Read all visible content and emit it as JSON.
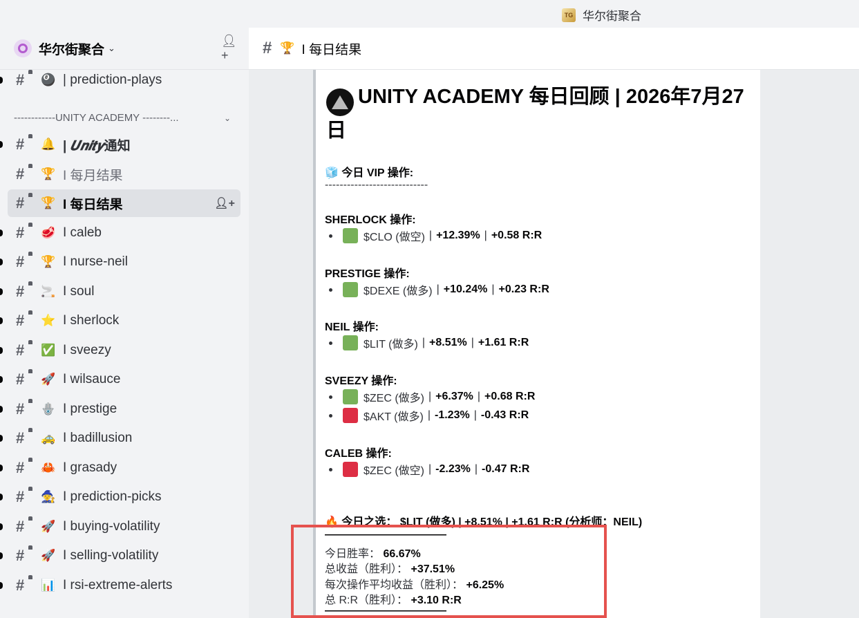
{
  "titlebar": {
    "server_name": "华尔街聚合",
    "logo_text": "TG"
  },
  "sidebar": {
    "server_name": "华尔街聚合",
    "category": "------------UNITY ACADEMY --------...",
    "channels": [
      {
        "emoji": "🎱",
        "label": "| prediction-plays"
      },
      {
        "emoji": "🔔",
        "label_prefix": "| ",
        "label_italic": "𝑼𝒏𝒊𝒕𝒚",
        "label_suffix": "通知"
      },
      {
        "emoji": "🏆",
        "label": "I 每月结果"
      },
      {
        "emoji": "🏆",
        "label": "I 每日结果"
      },
      {
        "emoji": "🥩",
        "label": "I caleb"
      },
      {
        "emoji": "🏆",
        "label": "I nurse-neil"
      },
      {
        "emoji": "🚬",
        "label": "I soul"
      },
      {
        "emoji": "⭐",
        "label": "I sherlock"
      },
      {
        "emoji": "✅",
        "label": "I sveezy"
      },
      {
        "emoji": "🚀",
        "label": "I wilsauce"
      },
      {
        "emoji": "🪬",
        "label": "I prestige"
      },
      {
        "emoji": "🚕",
        "label": "I badillusion"
      },
      {
        "emoji": "🦀",
        "label": "I grasady"
      },
      {
        "emoji": "🧙",
        "label": "I prediction-picks"
      },
      {
        "emoji": "🚀",
        "label": "I buying-volatility"
      },
      {
        "emoji": "🚀",
        "label": "I selling-volatility"
      },
      {
        "emoji": "📊",
        "label": "I rsi-extreme-alerts"
      }
    ]
  },
  "header": {
    "emoji": "🏆",
    "title": "I 每日结果"
  },
  "post": {
    "title": "UNITY ACADEMY 每日回顾 | 2026年7月27日",
    "vip_heading": "🧊 今日 VIP 操作:",
    "divider": "----------------------------",
    "sections": [
      {
        "heading": "SHERLOCK 操作:",
        "trades": [
          {
            "ticker": "$CLO (做空)",
            "pct": "+12.39%",
            "rr": "+0.58 R:R",
            "result": "win"
          }
        ]
      },
      {
        "heading": "PRESTIGE 操作:",
        "trades": [
          {
            "ticker": "$DEXE (做多)",
            "pct": "+10.24%",
            "rr": "+0.23 R:R",
            "result": "win"
          }
        ]
      },
      {
        "heading": "NEIL 操作:",
        "trades": [
          {
            "ticker": "$LIT (做多)",
            "pct": "+8.51%",
            "rr": "+1.61 R:R",
            "result": "win"
          }
        ]
      },
      {
        "heading": "SVEEZY 操作:",
        "trades": [
          {
            "ticker": "$ZEC (做多)",
            "pct": "+6.37%",
            "rr": "+0.68 R:R",
            "result": "win"
          },
          {
            "ticker": "$AKT (做多)",
            "pct": "-1.23%",
            "rr": "-0.43 R:R",
            "result": "loss"
          }
        ]
      },
      {
        "heading": "CALEB 操作:",
        "trades": [
          {
            "ticker": "$ZEC (做空)",
            "pct": "-2.23%",
            "rr": "-0.47 R:R",
            "result": "loss"
          }
        ]
      }
    ],
    "pick": "🔥 今日之选： $LIT (做多) | +8.51% | +1.61 R:R (分析师：NEIL)",
    "divider2": "———————————",
    "stats": [
      {
        "label": "今日胜率：",
        "value": "66.67%"
      },
      {
        "label": "总收益（胜利）：",
        "value": "+37.51%"
      },
      {
        "label": "每次操作平均收益（胜利）：",
        "value": "+6.25%"
      },
      {
        "label": "总 R:R（胜利）：",
        "value": "+3.10 R:R"
      }
    ],
    "divider3": "———————————"
  },
  "colors": {
    "win": "#78b159",
    "loss": "#dd2e44",
    "highlight": "#e5524e"
  }
}
